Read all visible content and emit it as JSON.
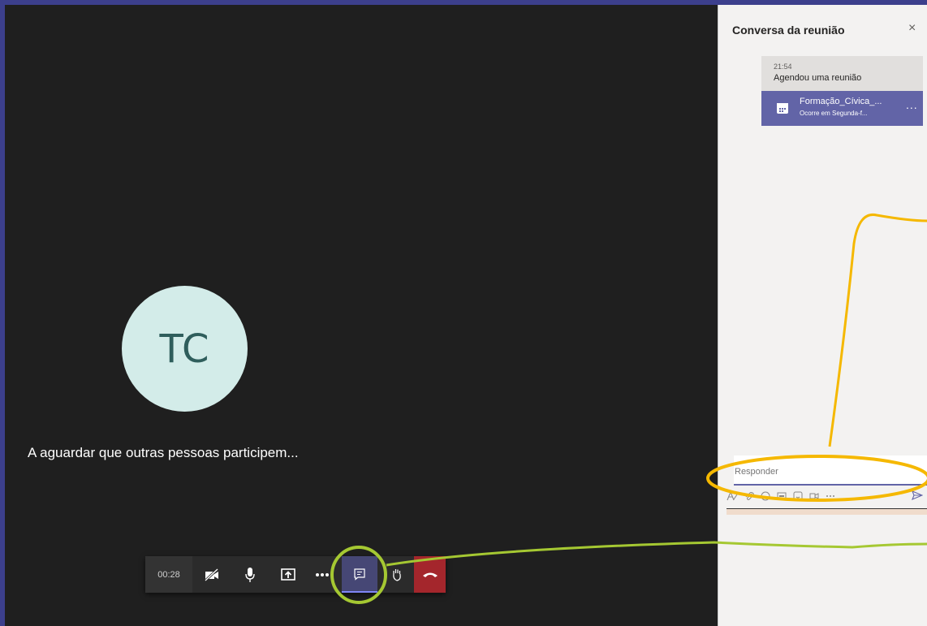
{
  "call": {
    "avatar_initials": "TC",
    "waiting_text": "A aguardar que outras pessoas participem...",
    "toolbar": {
      "timer": "00:28",
      "buttons": [
        {
          "name": "camera-off-icon"
        },
        {
          "name": "microphone-icon"
        },
        {
          "name": "share-screen-icon"
        },
        {
          "name": "more-actions-icon"
        },
        {
          "name": "chat-icon",
          "active": true
        },
        {
          "name": "raise-hand-icon"
        },
        {
          "name": "hang-up-icon"
        }
      ]
    }
  },
  "chat_panel": {
    "title": "Conversa da reunião",
    "close_glyph": "×",
    "message": {
      "time": "21:54",
      "text": "Agendou uma reunião",
      "card_title": "Formação_Cívica_...",
      "card_subtitle": "Ocorre em Segunda-f...",
      "card_more": "..."
    },
    "reply_placeholder": "Responder",
    "compose_tools": [
      "format-icon",
      "attach-icon",
      "emoji-icon",
      "gif-icon",
      "sticker-icon",
      "meet-icon",
      "more-options-icon",
      "send-icon"
    ]
  },
  "colors": {
    "frame": "#3c3f8c",
    "stage": "#1f1f1f",
    "accent": "#6264a7",
    "hangup": "#a4262c",
    "annotation_yellow": "#f5b800",
    "annotation_green": "#a5c832"
  }
}
